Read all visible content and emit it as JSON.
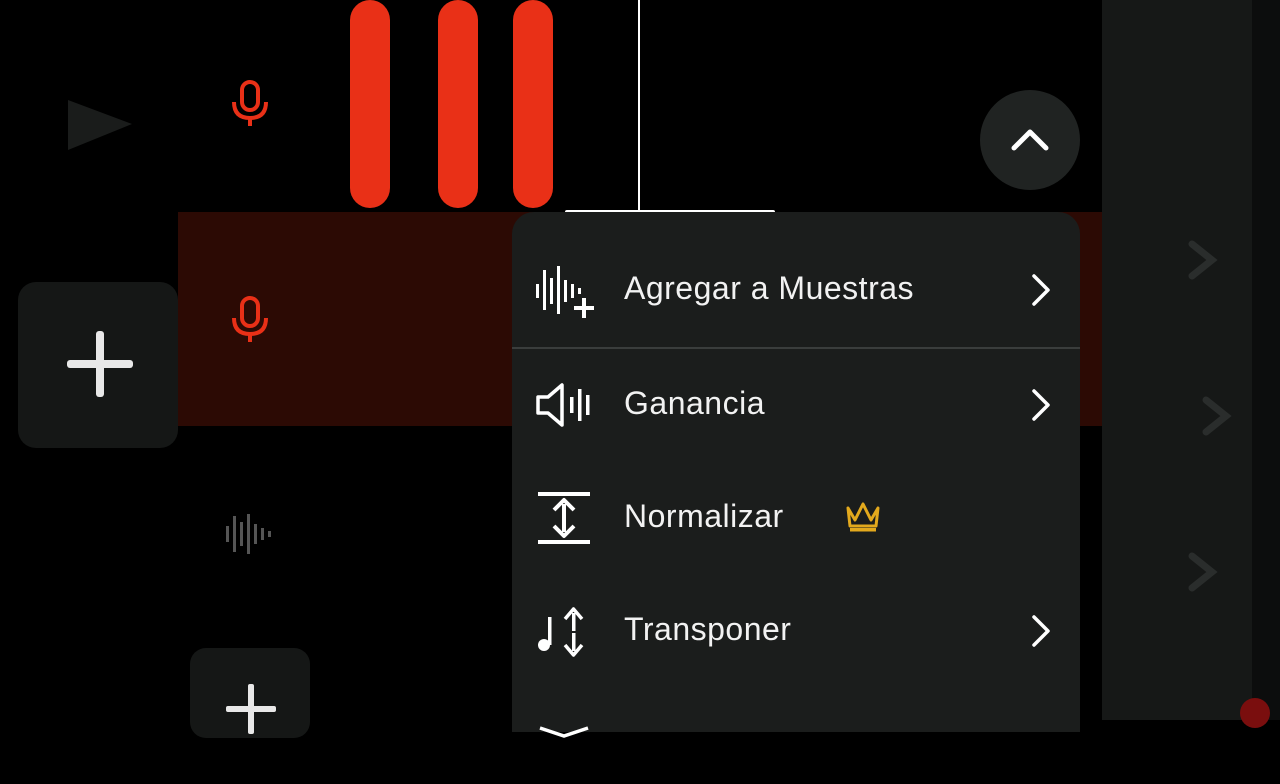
{
  "menu": {
    "items": [
      {
        "label": "Agregar a Muestras",
        "icon": "add-to-samples-icon",
        "has_submenu": true
      },
      {
        "label": "Ganancia",
        "icon": "speaker-volume-icon",
        "has_submenu": true
      },
      {
        "label": "Normalizar",
        "icon": "normalize-icon",
        "has_submenu": false,
        "premium": true
      },
      {
        "label": "Transponer",
        "icon": "transpose-icon",
        "has_submenu": true
      }
    ]
  },
  "colors": {
    "accent": "#e93017",
    "active_track_bg": "#2c0a04",
    "menu_bg": "#1b1d1c",
    "premium": "#e3a91d"
  }
}
